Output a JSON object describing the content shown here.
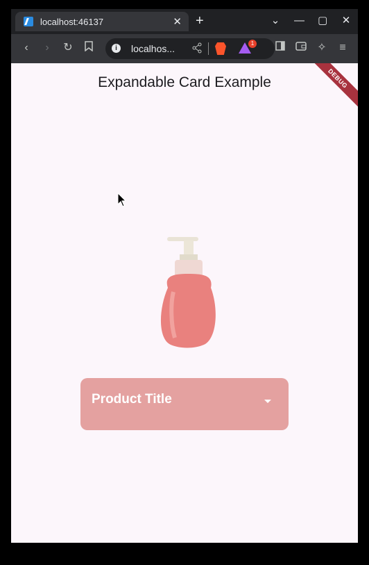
{
  "browser": {
    "tab_title": "localhost:46137",
    "tab_close": "✕",
    "new_tab": "+",
    "url": "localhos...",
    "rewards_count": "1",
    "window_controls": {
      "dropdown": "⌄",
      "minimize": "—",
      "maximize": "▢",
      "close": "✕"
    }
  },
  "page": {
    "title": "Expandable Card Example",
    "debug_banner": "DEBUG",
    "card": {
      "title": "Product Title"
    }
  },
  "colors": {
    "page_bg": "#fcf6fb",
    "card_bg": "#e4a1a0",
    "debug_banner": "#a8323e",
    "bottle_body": "#e9817e"
  },
  "icons": [
    "flutter-favicon",
    "back-icon",
    "forward-icon",
    "reload-icon",
    "bookmark-icon",
    "info-icon",
    "share-icon",
    "brave-shield-icon",
    "brave-rewards-icon",
    "sidebar-icon",
    "wallet-icon",
    "leo-icon",
    "menu-icon",
    "dropdown-arrow-icon",
    "cursor-icon"
  ]
}
